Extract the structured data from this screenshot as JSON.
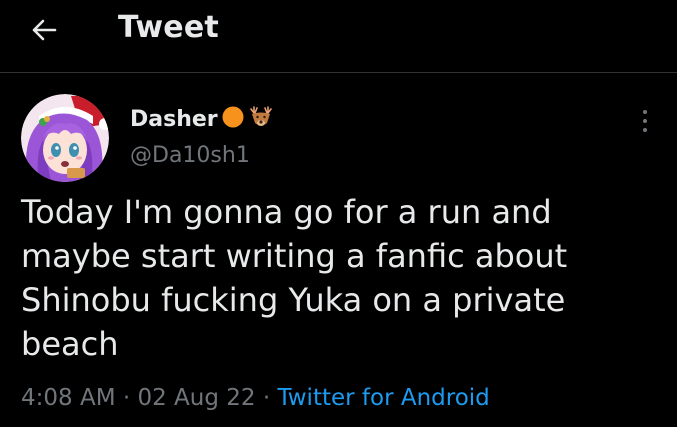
{
  "header": {
    "title": "Tweet",
    "back_icon": "arrow-left-icon"
  },
  "tweet": {
    "display_name": "Dasher",
    "name_emojis": [
      "orange-circle-emoji",
      "deer-emoji"
    ],
    "handle": "@Da10sh1",
    "text": "Today I'm gonna go for a run and\nmaybe start writing a fanfic about\nShinobu fucking Yuka on a private\nbeach",
    "time": "4:08 AM",
    "date": "02 Aug 22",
    "separator": "·",
    "source": "Twitter for Android",
    "more_icon": "more-vertical-icon"
  },
  "colors": {
    "background": "#000000",
    "text_primary": "#E7E9EA",
    "text_secondary": "#71767B",
    "link": "#1D9BF0",
    "divider": "#2F3336"
  }
}
